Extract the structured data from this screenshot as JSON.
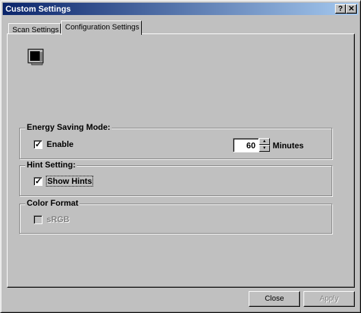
{
  "window": {
    "title": "Custom Settings",
    "help_label": "?",
    "close_label": "✕"
  },
  "tabs": [
    {
      "label": "Scan Settings",
      "selected": false
    },
    {
      "label": "Configuration Settings",
      "selected": true
    }
  ],
  "icon": {
    "name": "monitor-sleep-icon"
  },
  "energy_group": {
    "title": "Energy Saving Mode:",
    "enable_label": "Enable",
    "enable_checked": true,
    "minutes_value": "60",
    "minutes_unit": "Minutes"
  },
  "hint_group": {
    "title": "Hint Setting:",
    "show_hints_label": "Show Hints",
    "show_hints_checked": true
  },
  "color_group": {
    "title": "Color Format",
    "srgb_label": "sRGB",
    "srgb_checked": false,
    "srgb_enabled": false
  },
  "buttons": {
    "close_label": "Close",
    "apply_label": "Apply",
    "apply_enabled": false
  },
  "colors": {
    "titlebar_start": "#0a246a",
    "titlebar_end": "#a6caf0",
    "face": "#c0c0c0"
  }
}
